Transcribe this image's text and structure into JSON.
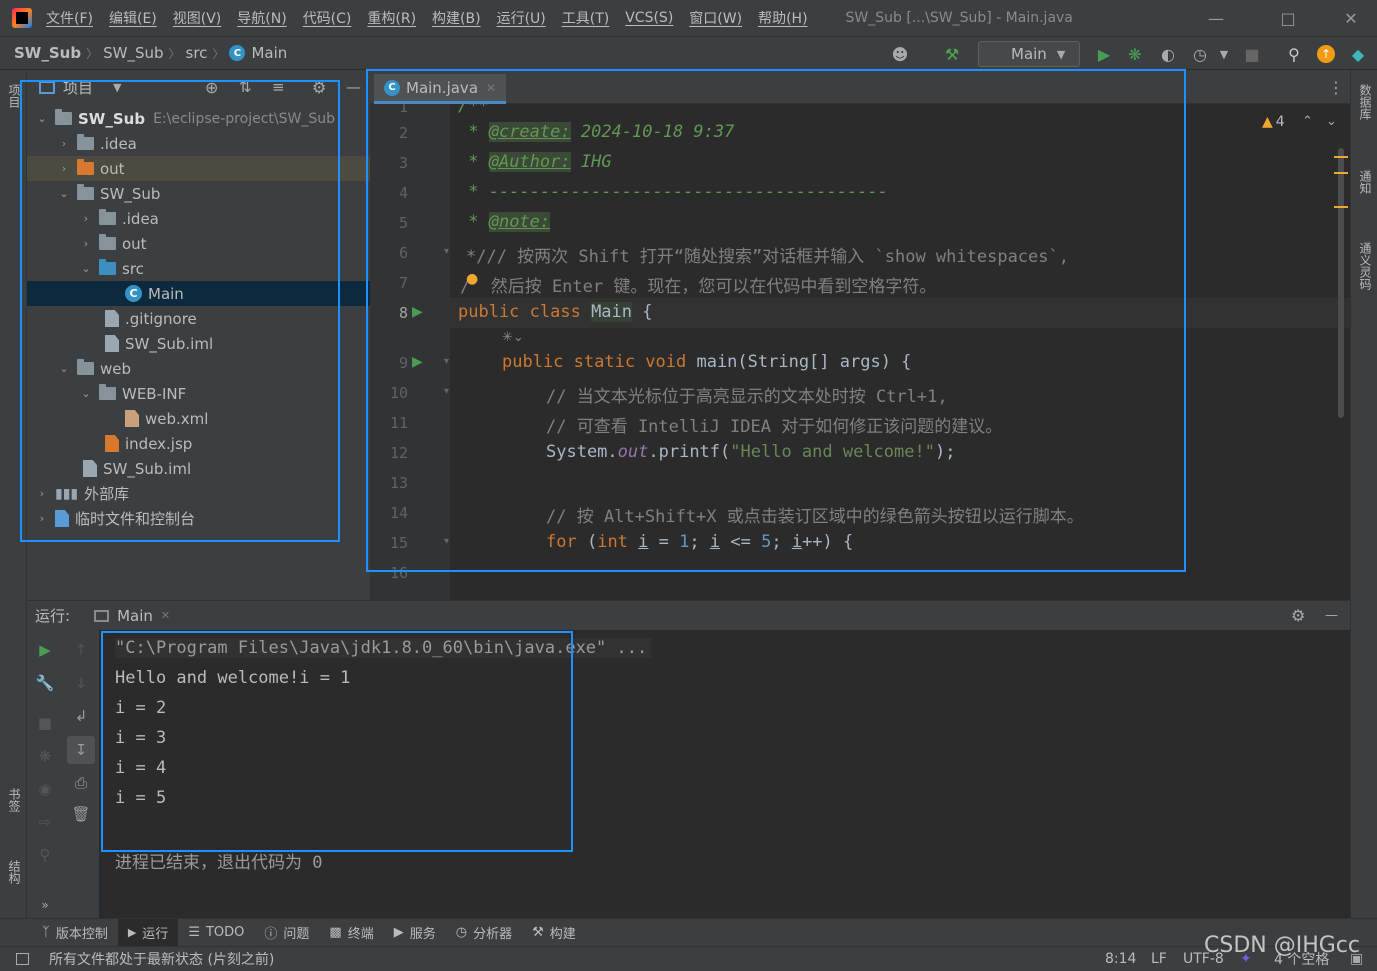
{
  "menu": {
    "items": [
      "文件(F)",
      "编辑(E)",
      "视图(V)",
      "导航(N)",
      "代码(C)",
      "重构(R)",
      "构建(B)",
      "运行(U)",
      "工具(T)",
      "VCS(S)",
      "窗口(W)",
      "帮助(H)"
    ],
    "window_title": "SW_Sub [...\\SW_Sub] - Main.java"
  },
  "breadcrumb": [
    "SW_Sub",
    "SW_Sub",
    "src",
    "Main"
  ],
  "run_config": "Main",
  "left_strip": {
    "project": "项目",
    "bookmarks": "书签",
    "structure": "结构"
  },
  "right_strip": {
    "database": "数据库",
    "notifications": "通知",
    "code_review": "通义灵码"
  },
  "project": {
    "header": "项目",
    "tree": [
      {
        "label": "SW_Sub",
        "path": "E:\\eclipse-project\\SW_Sub"
      },
      {
        "label": ".idea"
      },
      {
        "label": "out"
      },
      {
        "label": "SW_Sub"
      },
      {
        "label": ".idea"
      },
      {
        "label": "out"
      },
      {
        "label": "src"
      },
      {
        "label": "Main"
      },
      {
        "label": ".gitignore"
      },
      {
        "label": "SW_Sub.iml"
      },
      {
        "label": "web"
      },
      {
        "label": "WEB-INF"
      },
      {
        "label": "web.xml"
      },
      {
        "label": "index.jsp"
      },
      {
        "label": "SW_Sub.iml"
      },
      {
        "label": "外部库"
      },
      {
        "label": "临时文件和控制台"
      }
    ]
  },
  "editor": {
    "tab": "Main.java",
    "warnings": "4",
    "line_numbers": [
      "1",
      "2",
      "3",
      "4",
      "5",
      "6",
      "7",
      "8",
      "",
      "9",
      "10",
      "11",
      "12",
      "13",
      "14",
      "15",
      "16"
    ],
    "code": {
      "l1": "/**",
      "create_tag": "@create:",
      "create_val": " 2024-10-18 9:37",
      "author_tag": "@Author:",
      "author_val": " IHG",
      "dashes": " * ---------------------------------------",
      "note_tag": "@note:",
      "l6": "*/// 按两次 Shift 打开“随处搜索”对话框并输入 `show whitespaces`,",
      "l7": "/  然后按 Enter 键。现在，您可以在代码中看到空格字符。",
      "l8_kw": "public class ",
      "l8_name": "Main",
      "l8_end": " {",
      "l9_kw": "public static void ",
      "l9_rest": "main(String[] args) {",
      "l10": "// 当文本光标位于高亮显示的文本处时按 Ctrl+1,",
      "l11": "// 可查看 IntelliJ IDEA 对于如何修正该问题的建议。",
      "l12_a": "System.",
      "l12_out": "out",
      "l12_b": ".printf(",
      "l12_str": "\"Hello and welcome!\"",
      "l12_c": ");",
      "l14": "// 按 Alt+Shift+X 或点击装订区域中的绿色箭头按钮以运行脚本。",
      "l15_for": "for",
      "l15_int": "int",
      "l15_rest_a": " (",
      "l15_i1": "i",
      "l15_eq": " = ",
      "l15_one": "1",
      "l15_semi": "; ",
      "l15_i2": "i",
      "l15_le": " <= ",
      "l15_five": "5",
      "l15_semi2": "; ",
      "l15_i3": "i",
      "l15_end": "++) {"
    }
  },
  "run": {
    "label": "运行:",
    "tab": "Main",
    "console": [
      "\"C:\\Program Files\\Java\\jdk1.8.0_60\\bin\\java.exe\" ...",
      "Hello and welcome!i = 1",
      "i = 2",
      "i = 3",
      "i = 4",
      "i = 5",
      "",
      "进程已结束，退出代码为 0"
    ]
  },
  "bottom_tools": [
    "版本控制",
    "运行",
    "TODO",
    "问题",
    "终端",
    "服务",
    "分析器",
    "构建"
  ],
  "status": {
    "message": "所有文件都处于最新状态 (片刻之前)",
    "position": "8:14",
    "line_sep": "LF",
    "encoding": "UTF-8",
    "indent": "4 个空格",
    "watermark": "CSDN @IHGcc"
  },
  "colors": {
    "accent": "#1e90ff",
    "run_green": "#499c54",
    "warning": "#f0a732"
  }
}
